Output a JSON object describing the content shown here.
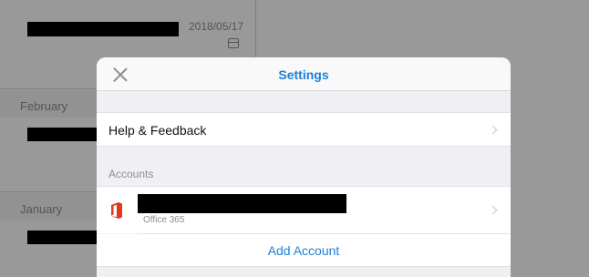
{
  "background": {
    "top_row_date": "2018/05/17",
    "sections": [
      "February",
      "January"
    ]
  },
  "settings": {
    "title": "Settings",
    "close_icon": "close-icon",
    "help_label": "Help & Feedback",
    "accounts_header": "Accounts",
    "account": {
      "type_label": "Office 365",
      "icon": "office-365-icon"
    },
    "add_account_label": "Add Account"
  },
  "colors": {
    "accent": "#1f7fd9",
    "office_red": "#e3371e",
    "secondary_text": "#8e8e93"
  }
}
